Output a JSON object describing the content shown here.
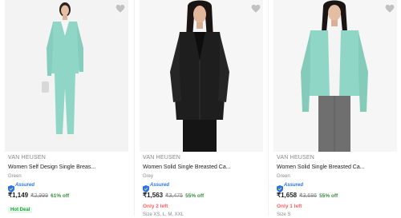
{
  "products": [
    {
      "brand": "VAN HEUSEN",
      "title": "Women Self Design Single Breas...",
      "color": "Green",
      "assured_label": "Assured",
      "price": "₹1,149",
      "mrp": "₹2,999",
      "discount": "61% off",
      "badge": "Hot Deal",
      "wishlist_icon": "heart-icon"
    },
    {
      "brand": "VAN HEUSEN",
      "title": "Women Solid Single Breasted Ca...",
      "color": "Grey",
      "assured_label": "Assured",
      "price": "₹1,563",
      "mrp": "₹3,475",
      "discount": "55% off",
      "stock": "Only 2 left",
      "size": "Size XS, L, M, XXL",
      "wishlist_icon": "heart-icon"
    },
    {
      "brand": "VAN HEUSEN",
      "title": "Women Solid Single Breasted Ca...",
      "color": "Green",
      "assured_label": "Assured",
      "price": "₹1,658",
      "mrp": "₹3,686",
      "discount": "55% off",
      "stock": "Only 1 left",
      "size": "Size S",
      "wishlist_icon": "heart-icon"
    }
  ],
  "colors": {
    "brand_text": "#878787",
    "assured_blue": "#2874f0",
    "discount_green": "#388e3c",
    "stock_red": "#ff6161",
    "mint_blazer": "#8fd6c6",
    "black_blazer": "#1e1e1e"
  }
}
